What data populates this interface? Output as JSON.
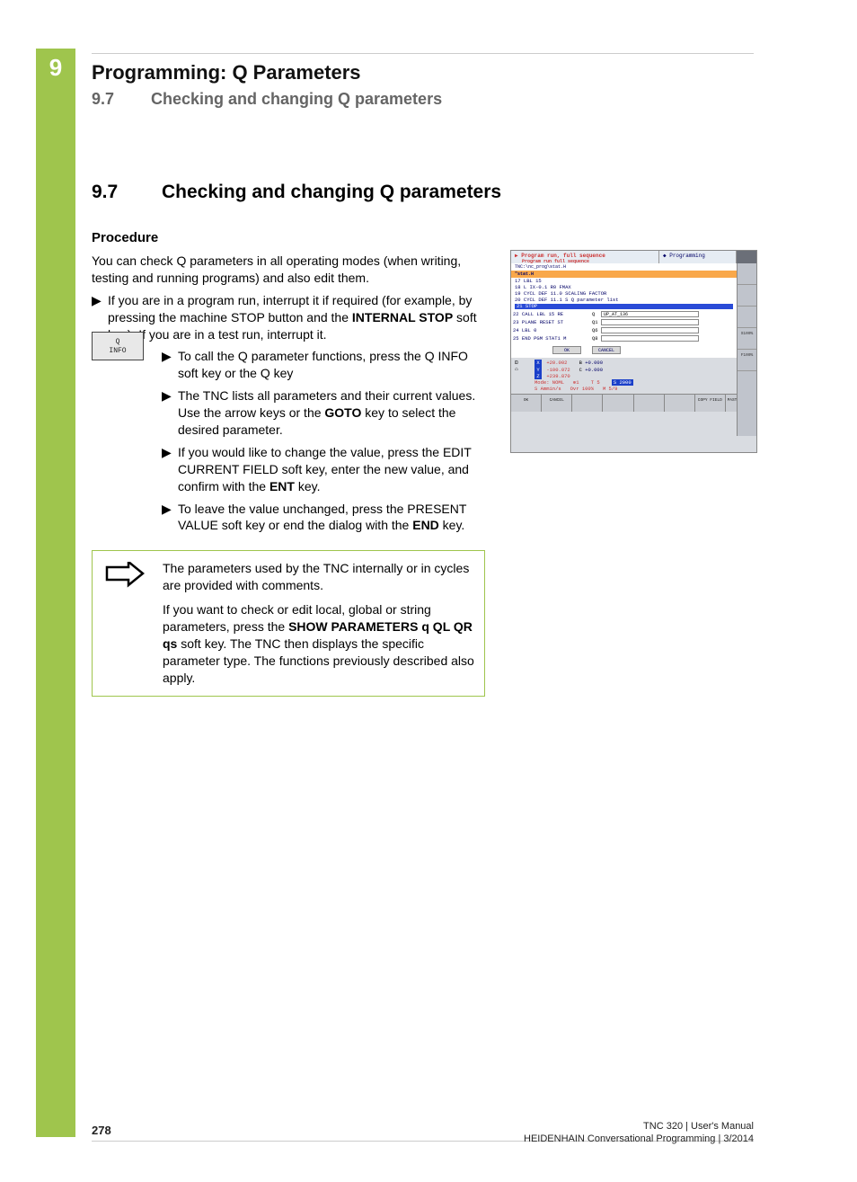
{
  "chapter": {
    "number": "9",
    "title": "Programming: Q Parameters",
    "section_number": "9.7",
    "section_title": "Checking and changing Q parameters"
  },
  "heading": {
    "number": "9.7",
    "title": "Checking and changing Q parameters"
  },
  "procedure": {
    "heading": "Procedure",
    "intro": "You can check Q parameters in all operating modes (when writing, testing and running programs) and also edit them.",
    "bullets": [
      {
        "text_pre": "If you are in a program run, interrupt it if required (for example, by pressing the machine STOP button and the ",
        "bold1": "INTERNAL STOP",
        "text_post": " soft key). If you are in a test run, interrupt it."
      }
    ],
    "softkey": {
      "line1": "Q",
      "line2": "INFO"
    },
    "sub_bullets": [
      "To call the Q parameter functions, press the Q INFO soft key or the Q key",
      {
        "pre": "The TNC lists all parameters and their current values. Use the arrow keys or the ",
        "bold": "GOTO",
        "post": " key to select the desired parameter."
      },
      {
        "pre": "If you would like to change the value, press the EDIT CURRENT FIELD soft key, enter the new value, and confirm with the ",
        "bold": "ENT",
        "post": " key."
      },
      {
        "pre": "To leave the value unchanged, press the PRESENT VALUE soft key or end the dialog with the ",
        "bold": "END",
        "post": " key."
      }
    ]
  },
  "note": {
    "p1": "The parameters used by the TNC internally or in cycles are provided with comments.",
    "p2_pre": "If you want to check or edit local, global or string parameters, press the ",
    "p2_bold": "SHOW PARAMETERS q QL QR qs",
    "p2_post": " soft key. The TNC then displays the specific parameter type. The functions previously described also apply."
  },
  "screenshot": {
    "title_left": "Program run, full sequence",
    "title_left_sub": "Program run full sequence",
    "title_right": "Programming",
    "path": "TNC:\\nc_prog\\stat.H",
    "orange": "\"stat.H",
    "code_lines": [
      "17 LBL 15",
      "18 L IX-0.1 R0 FMAX",
      "19 CYCL DEF 11.0 SCALING FACTOR",
      "20 CYCL DEF 11.1 S Q parameter list"
    ],
    "highlight": "21 STOP",
    "param_rows": [
      {
        "lbl": "22 CALL LBL 15 RE",
        "q": "Q",
        "val": "UP_AT_136"
      },
      {
        "lbl": "23 PLANE RESET ST",
        "q": "Q1",
        "val": ""
      },
      {
        "lbl": "24 LBL 0",
        "q": "Q6",
        "val": ""
      },
      {
        "lbl": "25 END PGM STAT1 M",
        "q": "Q8",
        "val": ""
      }
    ],
    "btn_ok": "OK",
    "btn_cancel": "CANCEL",
    "coords": {
      "x": {
        "ax": "X",
        "v": "+20.002",
        "b": "+0.000"
      },
      "y": {
        "ax": "Y",
        "v": "-100.072",
        "c": "+0.000"
      },
      "z": {
        "ax": "Z",
        "v": "+239.870"
      },
      "mode": "Mode: NOML",
      "sa": "S Ammin/s",
      "t5": "T 5",
      "s2000": "S 2000",
      "ovr": "Ovr 100%",
      "m": "M 5/9"
    },
    "softkeys": [
      "OK",
      "CANCEL",
      "",
      "",
      "",
      "",
      "COPY FIELD",
      "PASTE FIELD"
    ],
    "sidebar_labels": [
      "",
      "",
      "",
      "S100%",
      "F100%"
    ]
  },
  "footer": {
    "page": "278",
    "line1": "TNC 320 | User's Manual",
    "line2": "HEIDENHAIN Conversational Programming | 3/2014"
  }
}
